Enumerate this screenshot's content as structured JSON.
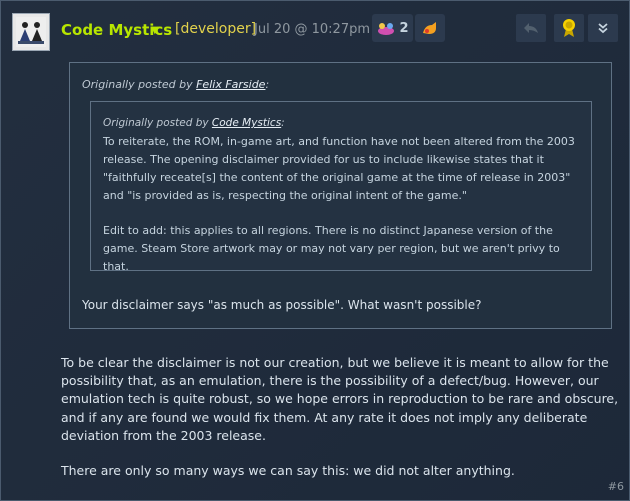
{
  "post": {
    "author": "Code Mystics",
    "role": "[developer]",
    "date": "Jul 20 @ 10:27pm",
    "award_count": "2",
    "post_number": "#6"
  },
  "outer_quote": {
    "prefix": "Originally posted by ",
    "author": "Felix Farside",
    "suffix": ":",
    "text": "Your disclaimer says \"as much as possible\". What wasn't possible?"
  },
  "inner_quote": {
    "prefix": "Originally posted by ",
    "author": "Code Mystics",
    "suffix": ":",
    "paragraph1": "To reiterate, the ROM, in-game art, and function have not been altered from the 2003 release. The opening disclaimer provided for us to include likewise states that it \"faithfully receate[s] the content of the original game at the time of release in 2003\" and \"is provided as is, respecting the original intent of the game.\"",
    "paragraph2": "Edit to add: this applies to all regions. There is no distinct Japanese version of the game. Steam Store artwork may or may not vary per region, but we aren't privy to that."
  },
  "reply": {
    "paragraph1": "To be clear the disclaimer is not our creation, but we believe it is meant to allow for the possibility that, as an emulation, there is the possibility of a defect/bug. However, our emulation tech is quite robust, so we hope errors in reproduction to be rare and obscure, and if any are found we would fix them. At any rate it does not imply any deliberate deviation from the 2003 release.",
    "paragraph2": "There are only so many ways we can say this: we did not alter anything."
  },
  "colors": {
    "username": "#b8e600",
    "role": "#e2d24c",
    "background": "#1f2b3c"
  },
  "icons": [
    "meditating-figures-avatar",
    "caret-down-icon",
    "award-icon",
    "award-icon-2",
    "reply-icon",
    "award-ribbon-icon",
    "chevron-double-down-icon"
  ]
}
